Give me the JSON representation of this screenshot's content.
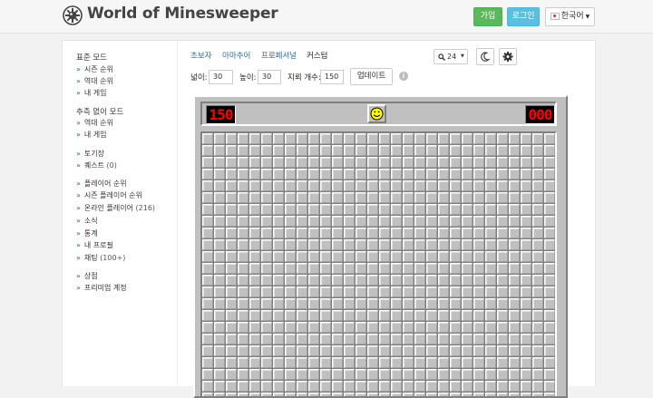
{
  "header": {
    "logo_text": "World of Minesweeper",
    "signup_label": "가입",
    "login_label": "로그인",
    "language_label": "한국어"
  },
  "sidebar": {
    "sections": [
      {
        "heading": "표준 모드",
        "items": [
          {
            "label": "시즌 순위"
          },
          {
            "label": "역대 순위"
          },
          {
            "label": "내 게임"
          }
        ]
      },
      {
        "heading": "추측 없이 모드",
        "items": [
          {
            "label": "역대 순위"
          },
          {
            "label": "내 게임"
          }
        ]
      },
      {
        "heading": "",
        "items": [
          {
            "label": "토기장"
          },
          {
            "label": "퀘스트",
            "count": "(0)"
          }
        ]
      },
      {
        "heading": "",
        "items": [
          {
            "label": "플레이어 순위"
          },
          {
            "label": "시즌 플레이어 순위"
          },
          {
            "label": "온라인 플레이어",
            "count": "(216)"
          },
          {
            "label": "소식"
          },
          {
            "label": "통계"
          },
          {
            "label": "내 프로필"
          },
          {
            "label": "채팅",
            "count": "(100+)"
          }
        ]
      },
      {
        "heading": "",
        "items": [
          {
            "label": "상점"
          },
          {
            "label": "프리미엄 계정"
          }
        ]
      }
    ]
  },
  "tabs": [
    {
      "label": "초보자",
      "active": false
    },
    {
      "label": "아마추어",
      "active": false
    },
    {
      "label": "프로페셔널",
      "active": false
    },
    {
      "label": "커스텀",
      "active": true
    }
  ],
  "toolbar": {
    "zoom_value": "24"
  },
  "params": {
    "width_label": "넓이:",
    "width_value": "30",
    "height_label": "높이:",
    "height_value": "30",
    "mines_label": "지뢰 개수:",
    "mines_value": "150",
    "update_label": "업데이트",
    "info_symbol": "i"
  },
  "game": {
    "mine_counter": "150",
    "timer": "000",
    "columns": 30,
    "rows": 30
  },
  "colors": {
    "counter_red": "#ff0000",
    "cell_face": "#c0c0c0",
    "signup_green": "#5cb85c",
    "login_blue": "#5bc0de",
    "link_blue": "#2a6fa8"
  }
}
